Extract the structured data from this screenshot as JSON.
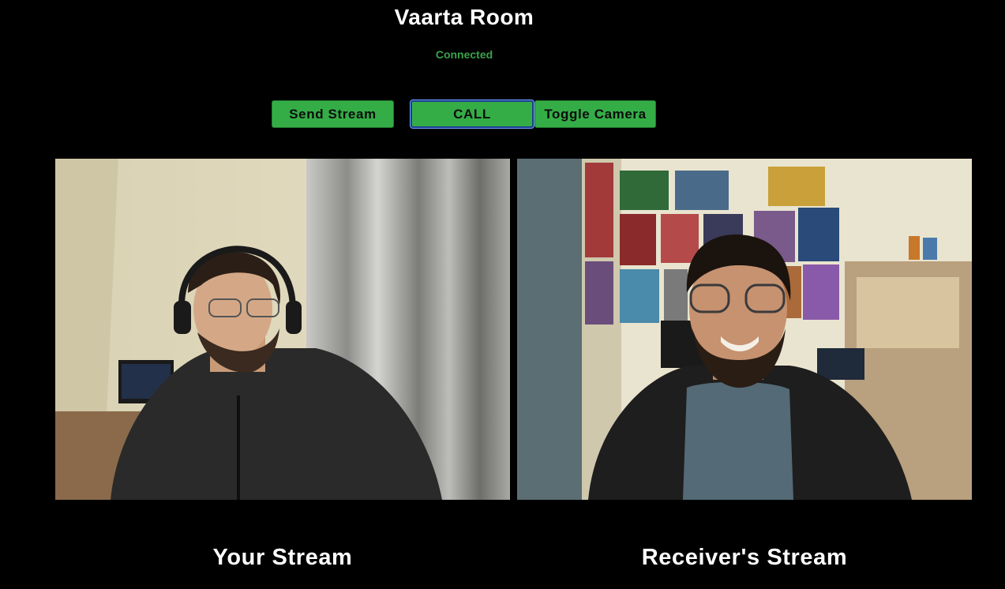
{
  "room": {
    "title": "Vaarta Room",
    "status": "Connected",
    "status_color": "#3aa14c"
  },
  "controls": {
    "send_stream_label": "Send Stream",
    "call_label": "CALL",
    "toggle_camera_label": "Toggle Camera",
    "button_color": "#35ad47"
  },
  "streams": {
    "local_caption": "Your Stream",
    "remote_caption": "Receiver's Stream"
  }
}
